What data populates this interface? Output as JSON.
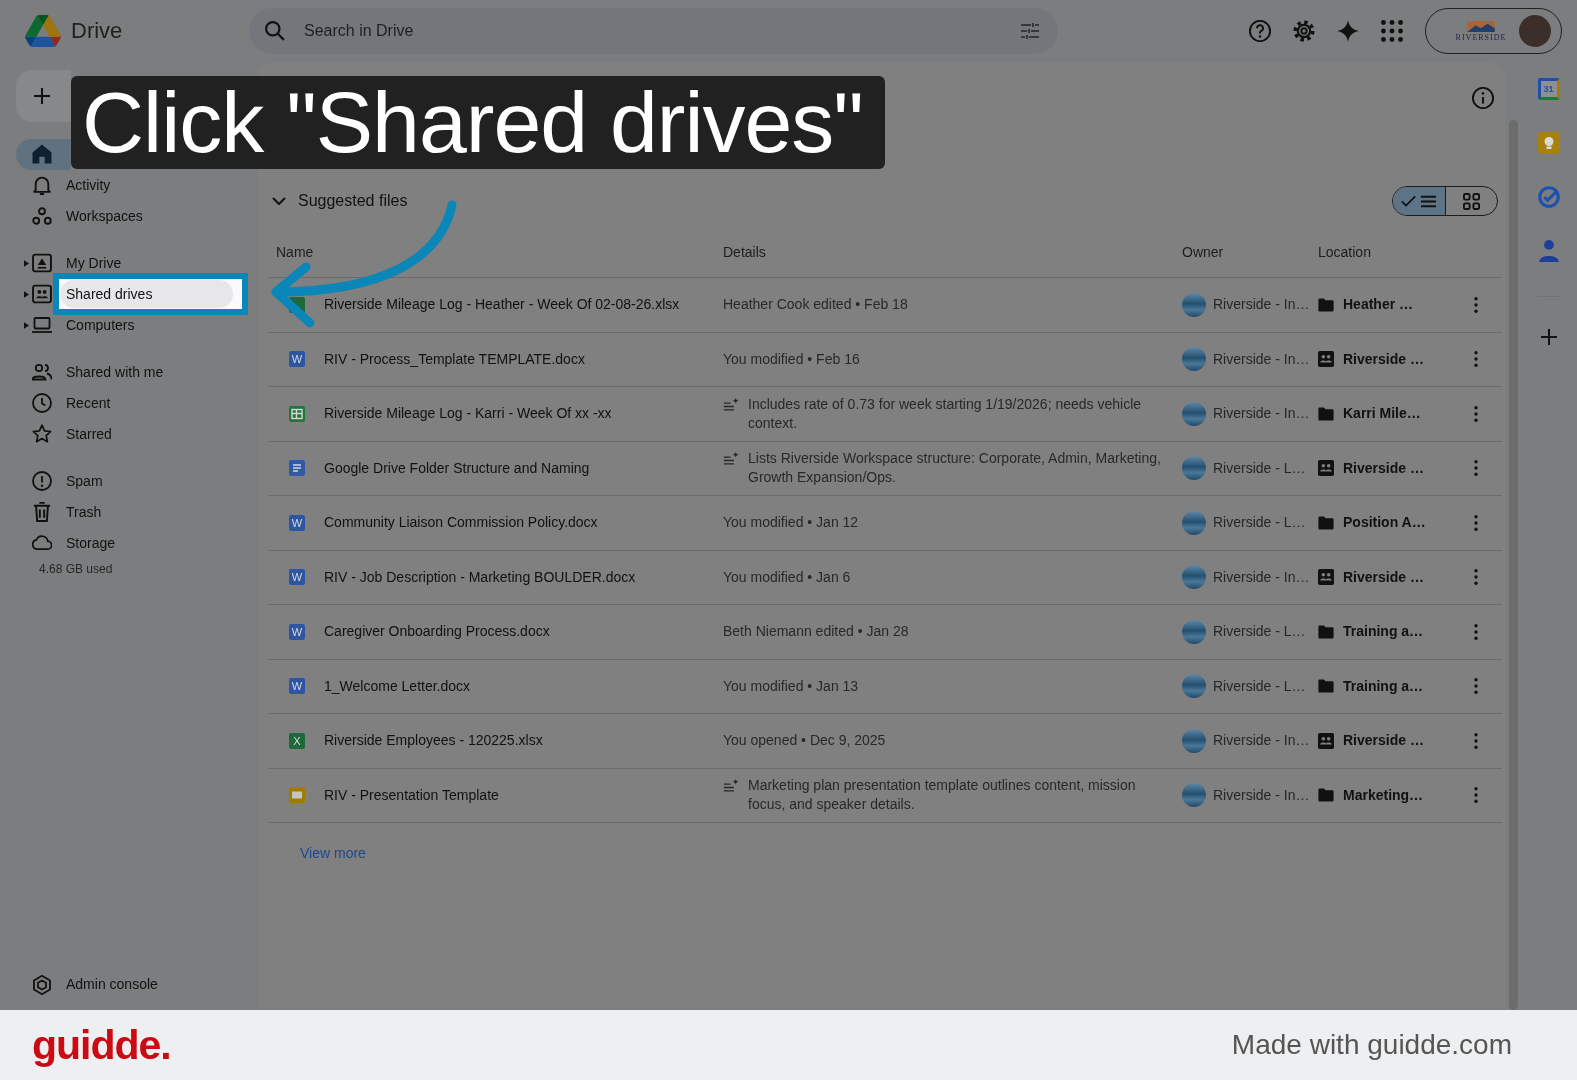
{
  "top_bar": {
    "app_name": "Drive",
    "search": {
      "placeholder": "Search in Drive"
    },
    "account": {
      "org_name": "RIVERSIDE"
    }
  },
  "sidebar": {
    "groups": [
      {
        "items": [
          {
            "kind": "home",
            "selected": true,
            "highlighted": false,
            "expandable": false
          },
          {
            "kind": "activity",
            "label": "Activity",
            "selected": false,
            "highlighted": false,
            "expandable": false
          },
          {
            "kind": "workspaces",
            "label": "Workspaces",
            "selected": false,
            "highlighted": false,
            "expandable": false
          }
        ]
      },
      {
        "items": [
          {
            "kind": "my_drive",
            "label": "My Drive",
            "selected": false,
            "highlighted": false,
            "expandable": true
          },
          {
            "kind": "shared_drives",
            "label": "Shared drives",
            "selected": false,
            "highlighted": true,
            "expandable": true
          },
          {
            "kind": "computers",
            "label": "Computers",
            "selected": false,
            "highlighted": false,
            "expandable": true
          }
        ]
      },
      {
        "items": [
          {
            "kind": "shared_with_me",
            "label": "Shared with me",
            "selected": false,
            "highlighted": false,
            "expandable": false
          },
          {
            "kind": "recent",
            "label": "Recent",
            "selected": false,
            "highlighted": false,
            "expandable": false
          },
          {
            "kind": "starred",
            "label": "Starred",
            "selected": false,
            "highlighted": false,
            "expandable": false
          }
        ]
      },
      {
        "items": [
          {
            "kind": "spam",
            "label": "Spam",
            "selected": false,
            "highlighted": false,
            "expandable": false
          },
          {
            "kind": "trash",
            "label": "Trash",
            "selected": false,
            "highlighted": false,
            "expandable": false
          },
          {
            "kind": "storage",
            "label": "Storage",
            "selected": false,
            "highlighted": false,
            "expandable": false
          }
        ]
      }
    ],
    "storage_used": "4.68 GB used",
    "footer_item": {
      "kind": "admin",
      "label": "Admin console"
    }
  },
  "main": {
    "section": {
      "title": "Suggested files",
      "expanded": true
    },
    "view": {
      "options": [
        {
          "kind": "list",
          "selected": true
        },
        {
          "kind": "grid",
          "selected": false
        }
      ]
    },
    "table": {
      "columns": [
        "Name",
        "Details",
        "Owner",
        "Location"
      ],
      "rows": [
        {
          "kind": "excel",
          "name": "Riverside Mileage Log - Heather - Week Of 02-08-26.xlsx",
          "details": "Heather Cook edited • Feb 18",
          "ai_summary": false,
          "owner": "Riverside - In…",
          "location": {
            "kind": "folder",
            "name": "Heather …"
          }
        },
        {
          "kind": "word",
          "icon_text": "W",
          "name": "RIV - Process_Template TEMPLATE.docx",
          "details": "You modified • Feb 16",
          "ai_summary": false,
          "owner": "Riverside - In…",
          "location": {
            "kind": "shared_drive",
            "name": "Riverside …"
          }
        },
        {
          "kind": "sheets",
          "name": "Riverside Mileage Log - Karri - Week Of xx -xx",
          "details": "Includes rate of 0.73 for week starting 1/19/2026; needs vehicle context.",
          "ai_summary": true,
          "owner": "Riverside - In…",
          "location": {
            "kind": "folder",
            "name": "Karri Mile…"
          }
        },
        {
          "kind": "docs",
          "name": "Google Drive Folder Structure and Naming",
          "details": "Lists Riverside Workspace structure: Corporate, Admin, Marketing, Growth Expansion/Ops.",
          "ai_summary": true,
          "owner": "Riverside - L…",
          "location": {
            "kind": "shared_drive",
            "name": "Riverside …"
          }
        },
        {
          "kind": "word",
          "icon_text": "W",
          "name": "Community Liaison Commission Policy.docx",
          "details": "You modified • Jan 12",
          "ai_summary": false,
          "owner": "Riverside - L…",
          "location": {
            "kind": "folder",
            "name": "Position A…"
          }
        },
        {
          "kind": "word",
          "icon_text": "W",
          "name": "RIV - Job Description - Marketing BOULDER.docx",
          "details": "You modified • Jan 6",
          "ai_summary": false,
          "owner": "Riverside - In…",
          "location": {
            "kind": "shared_drive",
            "name": "Riverside …"
          }
        },
        {
          "kind": "word",
          "icon_text": "W",
          "name": "Caregiver Onboarding Process.docx",
          "details": "Beth Niemann edited • Jan 28",
          "ai_summary": false,
          "owner": "Riverside - L…",
          "location": {
            "kind": "folder",
            "name": "Training a…"
          }
        },
        {
          "kind": "word",
          "icon_text": "W",
          "name": "1_Welcome Letter.docx",
          "details": "You modified • Jan 13",
          "ai_summary": false,
          "owner": "Riverside - L…",
          "location": {
            "kind": "folder",
            "name": "Training a…"
          }
        },
        {
          "kind": "excel",
          "icon_text": "X",
          "name": "Riverside Employees - 120225.xlsx",
          "details": "You opened • Dec 9, 2025",
          "ai_summary": false,
          "owner": "Riverside - In…",
          "location": {
            "kind": "shared_drive",
            "name": "Riverside …"
          }
        },
        {
          "kind": "slides",
          "name": "RIV - Presentation Template",
          "details": "Marketing plan presentation template outlines content, mission focus, and speaker details.",
          "ai_summary": true,
          "owner": "Riverside - In…",
          "location": {
            "kind": "folder",
            "name": "Marketing…"
          }
        }
      ]
    },
    "view_more": "View more"
  },
  "side_panel": {
    "apps": [
      {
        "kind": "calendar",
        "label": "31"
      },
      {
        "kind": "keep"
      },
      {
        "kind": "tasks"
      },
      {
        "kind": "contacts"
      }
    ]
  },
  "tutorial": {
    "callout": "Click \"Shared drives\""
  },
  "footer": {
    "logo": "guidde.",
    "credit": "Made with guidde.com"
  }
}
